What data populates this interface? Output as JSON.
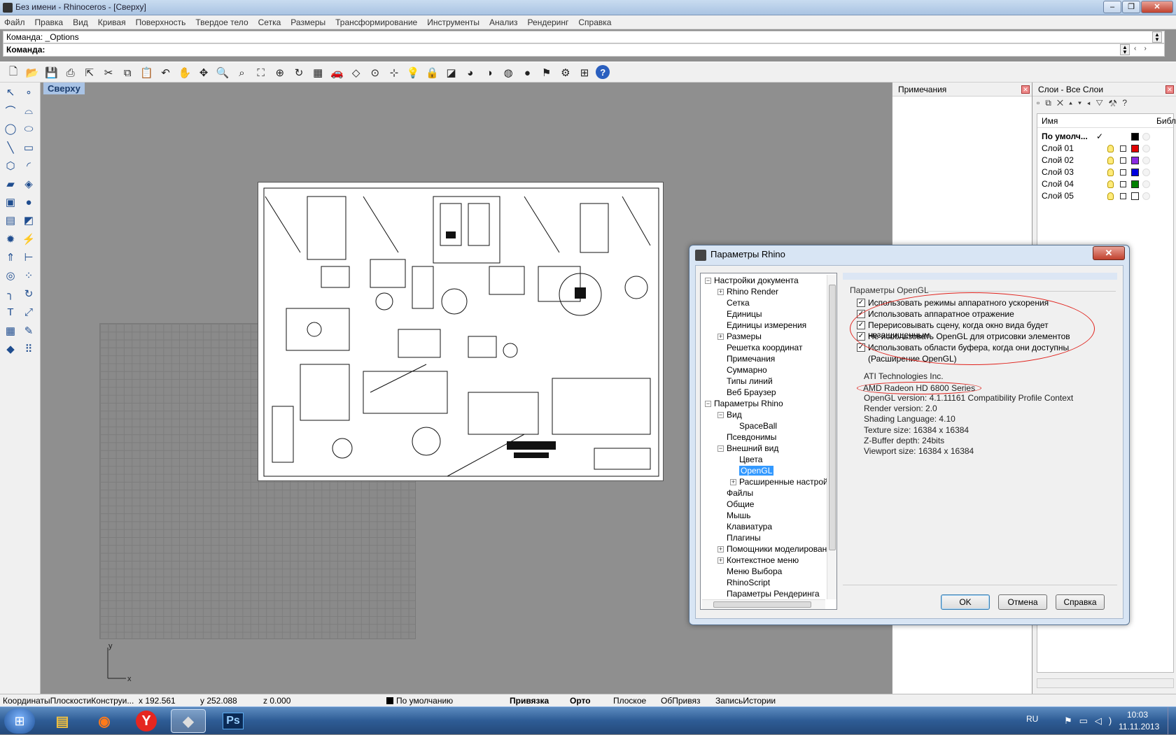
{
  "window": {
    "title": "Без имени - Rhinoceros - [Сверху]"
  },
  "menu": [
    "Файл",
    "Правка",
    "Вид",
    "Кривая",
    "Поверхность",
    "Твердое тело",
    "Сетка",
    "Размеры",
    "Трансформирование",
    "Инструменты",
    "Анализ",
    "Рендеринг",
    "Справка"
  ],
  "command": {
    "history": "Команда: _Options",
    "prompt": "Команда:",
    "value": ""
  },
  "viewport": {
    "tab": "Сверху",
    "axis_y": "y",
    "axis_x": "x"
  },
  "notes_panel": {
    "title": "Примечания"
  },
  "layers_panel": {
    "title": "Слои - Все Слои",
    "col_name": "Имя",
    "col_lib": "Библ",
    "rows": [
      {
        "name": "По умолч...",
        "check": "✓",
        "color": "#000000"
      },
      {
        "name": "Слой 01",
        "color": "#e00000"
      },
      {
        "name": "Слой 02",
        "color": "#8a2be2"
      },
      {
        "name": "Слой 03",
        "color": "#0000e0"
      },
      {
        "name": "Слой 04",
        "color": "#008000"
      },
      {
        "name": "Слой 05",
        "color": "#ffffff"
      }
    ]
  },
  "dialog": {
    "title": "Параметры Rhino",
    "tree": [
      {
        "label": "Настройки документа",
        "level": 0,
        "exp": "−"
      },
      {
        "label": "Rhino Render",
        "level": 1,
        "exp": "+"
      },
      {
        "label": "Сетка",
        "level": 1
      },
      {
        "label": "Единицы",
        "level": 1
      },
      {
        "label": "Единицы измерения",
        "level": 1
      },
      {
        "label": "Размеры",
        "level": 1,
        "exp": "+"
      },
      {
        "label": "Решетка координат",
        "level": 1
      },
      {
        "label": "Примечания",
        "level": 1
      },
      {
        "label": "Суммарно",
        "level": 1
      },
      {
        "label": "Типы линий",
        "level": 1
      },
      {
        "label": "Веб Браузер",
        "level": 1
      },
      {
        "label": "Параметры Rhino",
        "level": 0,
        "exp": "−"
      },
      {
        "label": "Вид",
        "level": 1,
        "exp": "−"
      },
      {
        "label": "SpaceBall",
        "level": 2
      },
      {
        "label": "Псевдонимы",
        "level": 1
      },
      {
        "label": "Внешний вид",
        "level": 1,
        "exp": "−"
      },
      {
        "label": "Цвета",
        "level": 2
      },
      {
        "label": "OpenGL",
        "level": 2,
        "selected": true
      },
      {
        "label": "Расширенные настрой",
        "level": 2,
        "exp": "+"
      },
      {
        "label": "Файлы",
        "level": 1
      },
      {
        "label": "Общие",
        "level": 1
      },
      {
        "label": "Мышь",
        "level": 1
      },
      {
        "label": "Клавиатура",
        "level": 1
      },
      {
        "label": "Плагины",
        "level": 1
      },
      {
        "label": "Помощники моделировани",
        "level": 1,
        "exp": "+"
      },
      {
        "label": "Контекстное меню",
        "level": 1,
        "exp": "+"
      },
      {
        "label": "Меню Выбора",
        "level": 1
      },
      {
        "label": "RhinoScript",
        "level": 1
      },
      {
        "label": "Параметры Рендеринга",
        "level": 1
      }
    ],
    "group_title": "Параметры OpenGL",
    "checkboxes": [
      "Использовать режимы аппаратного ускорения",
      "Использовать аппаратное отражение",
      "Перерисовывать сцену, когда окно вида будет незащищенным",
      "Не использовать OpenGL для отрисовки элементов",
      "Использовать области буфера, когда они доступны"
    ],
    "checkbox_note": "(Расширение OpenGL)",
    "vendor": "ATI Technologies Inc.",
    "renderer": "AMD Radeon HD 6800 Series",
    "info": [
      "OpenGL version: 4.1.11161 Compatibility Profile Context",
      "Render version: 2.0",
      "Shading Language: 4.10",
      "Texture size: 16384 x 16384",
      "Z-Buffer depth: 24bits",
      "Viewport size: 16384 x 16384"
    ],
    "ok": "OK",
    "cancel": "Отмена",
    "help": "Справка"
  },
  "status": {
    "cplane": "КоординатыПлоскостиКонструи...",
    "x": "x 192.561",
    "y": "y 252.088",
    "z": "z 0.000",
    "layer": "По умолчанию",
    "snap": "Привязка",
    "ortho": "Орто",
    "planar": "Плоское",
    "osnap": "ОбПривяз",
    "history": "ЗаписьИстории"
  },
  "taskbar": {
    "lang": "RU",
    "time": "10:03",
    "date": "11.11.2013"
  }
}
